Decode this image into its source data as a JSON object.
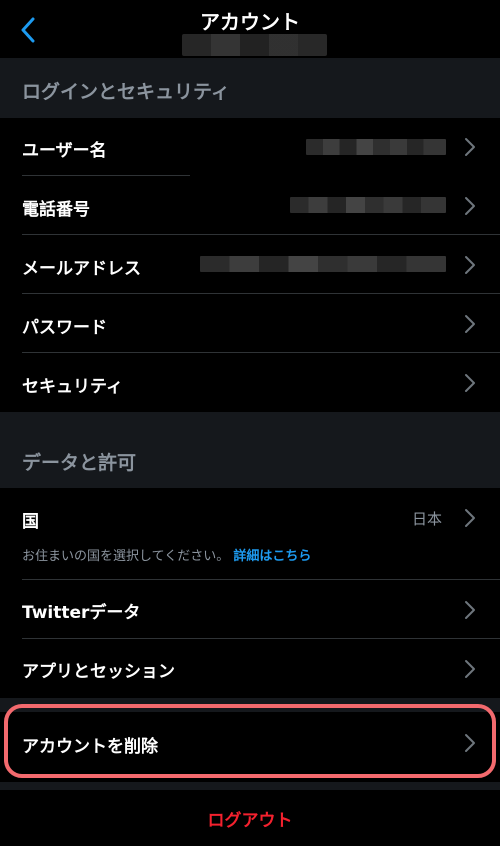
{
  "header": {
    "title": "アカウント"
  },
  "sections": {
    "login_security": {
      "title": "ログインとセキュリティ",
      "items": {
        "username": "ユーザー名",
        "phone": "電話番号",
        "email": "メールアドレス",
        "password": "パスワード",
        "security": "セキュリティ"
      }
    },
    "data_permissions": {
      "title": "データと許可",
      "items": {
        "country": "国",
        "country_value": "日本",
        "country_hint": "お住まいの国を選択してください。",
        "country_hint_link": "詳細はこちら",
        "twitter_data": "Twitterデータ",
        "apps_sessions": "アプリとセッション"
      }
    }
  },
  "delete_account": "アカウントを削除",
  "logout": "ログアウト",
  "colors": {
    "accent_link": "#1d9bf0",
    "logout_red": "#f4212e",
    "highlight": "#f36a6e",
    "section_bg": "#15181c",
    "muted_text": "#8b949e"
  }
}
